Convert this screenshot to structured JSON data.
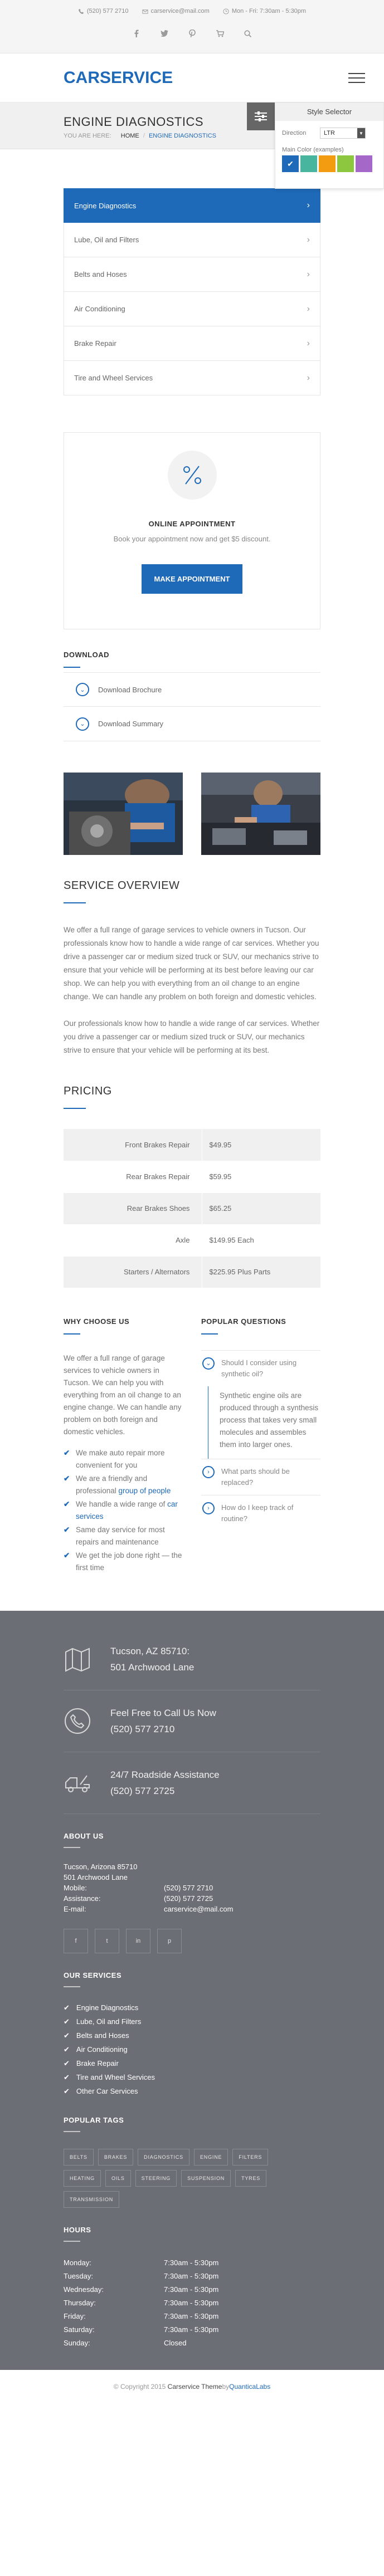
{
  "topbar": {
    "phone": "(520) 577 2710",
    "email": "carservice@mail.com",
    "hours": "Mon - Fri: 7:30am - 5:30pm",
    "social_icons": [
      "facebook-icon",
      "twitter-icon",
      "pinterest-icon",
      "cart-icon",
      "search-icon"
    ]
  },
  "header": {
    "logo": "CARSERVICE"
  },
  "title": {
    "heading": "Engine Diagnostics",
    "crumb_prefix": "YOU ARE HERE:",
    "crumb_home": "HOME",
    "crumb_current": "ENGINE DIAGNOSTICS"
  },
  "style_selector": {
    "title": "Style Selector",
    "direction_label": "Direction",
    "direction_value": "LTR",
    "main_color_label": "Main Color (examples)",
    "swatch_colors": [
      "#1e69b8",
      "#48b59f",
      "#f39c12",
      "#8dc63f",
      "#a567c8"
    ]
  },
  "services_menu": [
    {
      "label": "Engine Diagnostics"
    },
    {
      "label": "Lube, Oil and Filters"
    },
    {
      "label": "Belts and Hoses"
    },
    {
      "label": "Air Conditioning"
    },
    {
      "label": "Brake Repair"
    },
    {
      "label": "Tire and Wheel Services"
    }
  ],
  "appointment": {
    "title": "ONLINE APPOINTMENT",
    "text": "Book your appointment now and get $5 discount.",
    "button": "MAKE APPOINTMENT"
  },
  "download": {
    "heading": "DOWNLOAD",
    "items": [
      "Download Brochure",
      "Download Summary"
    ]
  },
  "overview": {
    "heading": "SERVICE OVERVIEW",
    "p1": "We offer a full range of garage services to vehicle owners in Tucson. Our professionals know how to handle a wide range of car services. Whether you drive a passenger car or medium sized truck or SUV, our mechanics strive to ensure that your vehicle will be performing at its best before leaving our car shop. We can help you with everything from an oil change to an engine change. We can handle any problem on both foreign and domestic vehicles.",
    "p2": "Our professionals know how to handle a wide range of car services. Whether you drive a passenger car or medium sized truck or SUV, our mechanics strive to ensure that your vehicle will be performing at its best."
  },
  "pricing": {
    "heading": "PRICING",
    "rows": [
      {
        "item": "Front Brakes Repair",
        "price": "$49.95"
      },
      {
        "item": "Rear Brakes Repair",
        "price": "$59.95"
      },
      {
        "item": "Rear Brakes Shoes",
        "price": "$65.25"
      },
      {
        "item": "Axle",
        "price": "$149.95 Each"
      },
      {
        "item": "Starters / Alternators",
        "price": "$225.95 Plus Parts"
      }
    ]
  },
  "why": {
    "heading": "WHY CHOOSE US",
    "text": "We offer a full range of garage services to vehicle owners in Tucson. We can help you with everything from an oil change to an engine change. We can handle any problem on both foreign and domestic vehicles.",
    "items": [
      {
        "text": "We make auto repair more convenient for you",
        "link": ""
      },
      {
        "text": "We are a friendly and professional ",
        "link": "group of people"
      },
      {
        "text": "We handle a wide range of ",
        "link": "car services"
      },
      {
        "text": "Same day service for most repairs and maintenance",
        "link": ""
      },
      {
        "text": "We get the job done right — the first time",
        "link": ""
      }
    ]
  },
  "faq": {
    "heading": "POPULAR QUESTIONS",
    "q1": "Should I consider using synthetic oil?",
    "a1": "Synthetic engine oils are produced through a synthesis process that takes very small molecules and assembles them into larger ones.",
    "q2": "What parts should be replaced?",
    "q3": "How do I keep track of routine?"
  },
  "footer": {
    "contact": [
      {
        "icon": "map-icon",
        "line1": "Tucson, AZ 85710:",
        "line2": "501 Archwood Lane"
      },
      {
        "icon": "phone-icon",
        "line1": "Feel Free to Call Us Now",
        "line2": "(520) 577 2710"
      },
      {
        "icon": "tow-truck-icon",
        "line1": "24/7 Roadside Assistance",
        "line2": "(520) 577 2725"
      }
    ],
    "about": {
      "heading": "ABOUT US",
      "addr1": "Tucson, Arizona 85710",
      "addr2": "501 Archwood Lane",
      "rows": [
        {
          "k": "Mobile:",
          "v": "(520) 577 2710"
        },
        {
          "k": "Assistance:",
          "v": "(520) 577 2725"
        },
        {
          "k": "E-mail:",
          "v": "carservice@mail.com"
        }
      ],
      "social": [
        "f",
        "t",
        "in",
        "p"
      ]
    },
    "services": {
      "heading": "OUR SERVICES",
      "items": [
        "Engine Diagnostics",
        "Lube, Oil and Filters",
        "Belts and Hoses",
        "Air Conditioning",
        "Brake Repair",
        "Tire and Wheel Services",
        "Other Car Services"
      ]
    },
    "tags": {
      "heading": "POPULAR TAGS",
      "items": [
        "BELTS",
        "BRAKES",
        "DIAGNOSTICS",
        "ENGINE",
        "FILTERS",
        "HEATING",
        "OILS",
        "STEERING",
        "SUSPENSION",
        "TYRES",
        "TRANSMISSION"
      ]
    },
    "hours": {
      "heading": "HOURS",
      "rows": [
        {
          "day": "Monday:",
          "time": "7:30am - 5:30pm"
        },
        {
          "day": "Tuesday:",
          "time": "7:30am - 5:30pm"
        },
        {
          "day": "Wednesday:",
          "time": "7:30am - 5:30pm"
        },
        {
          "day": "Thursday:",
          "time": "7:30am - 5:30pm"
        },
        {
          "day": "Friday:",
          "time": "7:30am - 5:30pm"
        },
        {
          "day": "Saturday:",
          "time": "7:30am - 5:30pm"
        },
        {
          "day": "Sunday:",
          "time": "Closed"
        }
      ]
    }
  },
  "copyright": {
    "prefix": "© Copyright 2015 ",
    "theme": "Carservice Theme",
    "by": " by ",
    "author": "QuanticaLabs"
  }
}
